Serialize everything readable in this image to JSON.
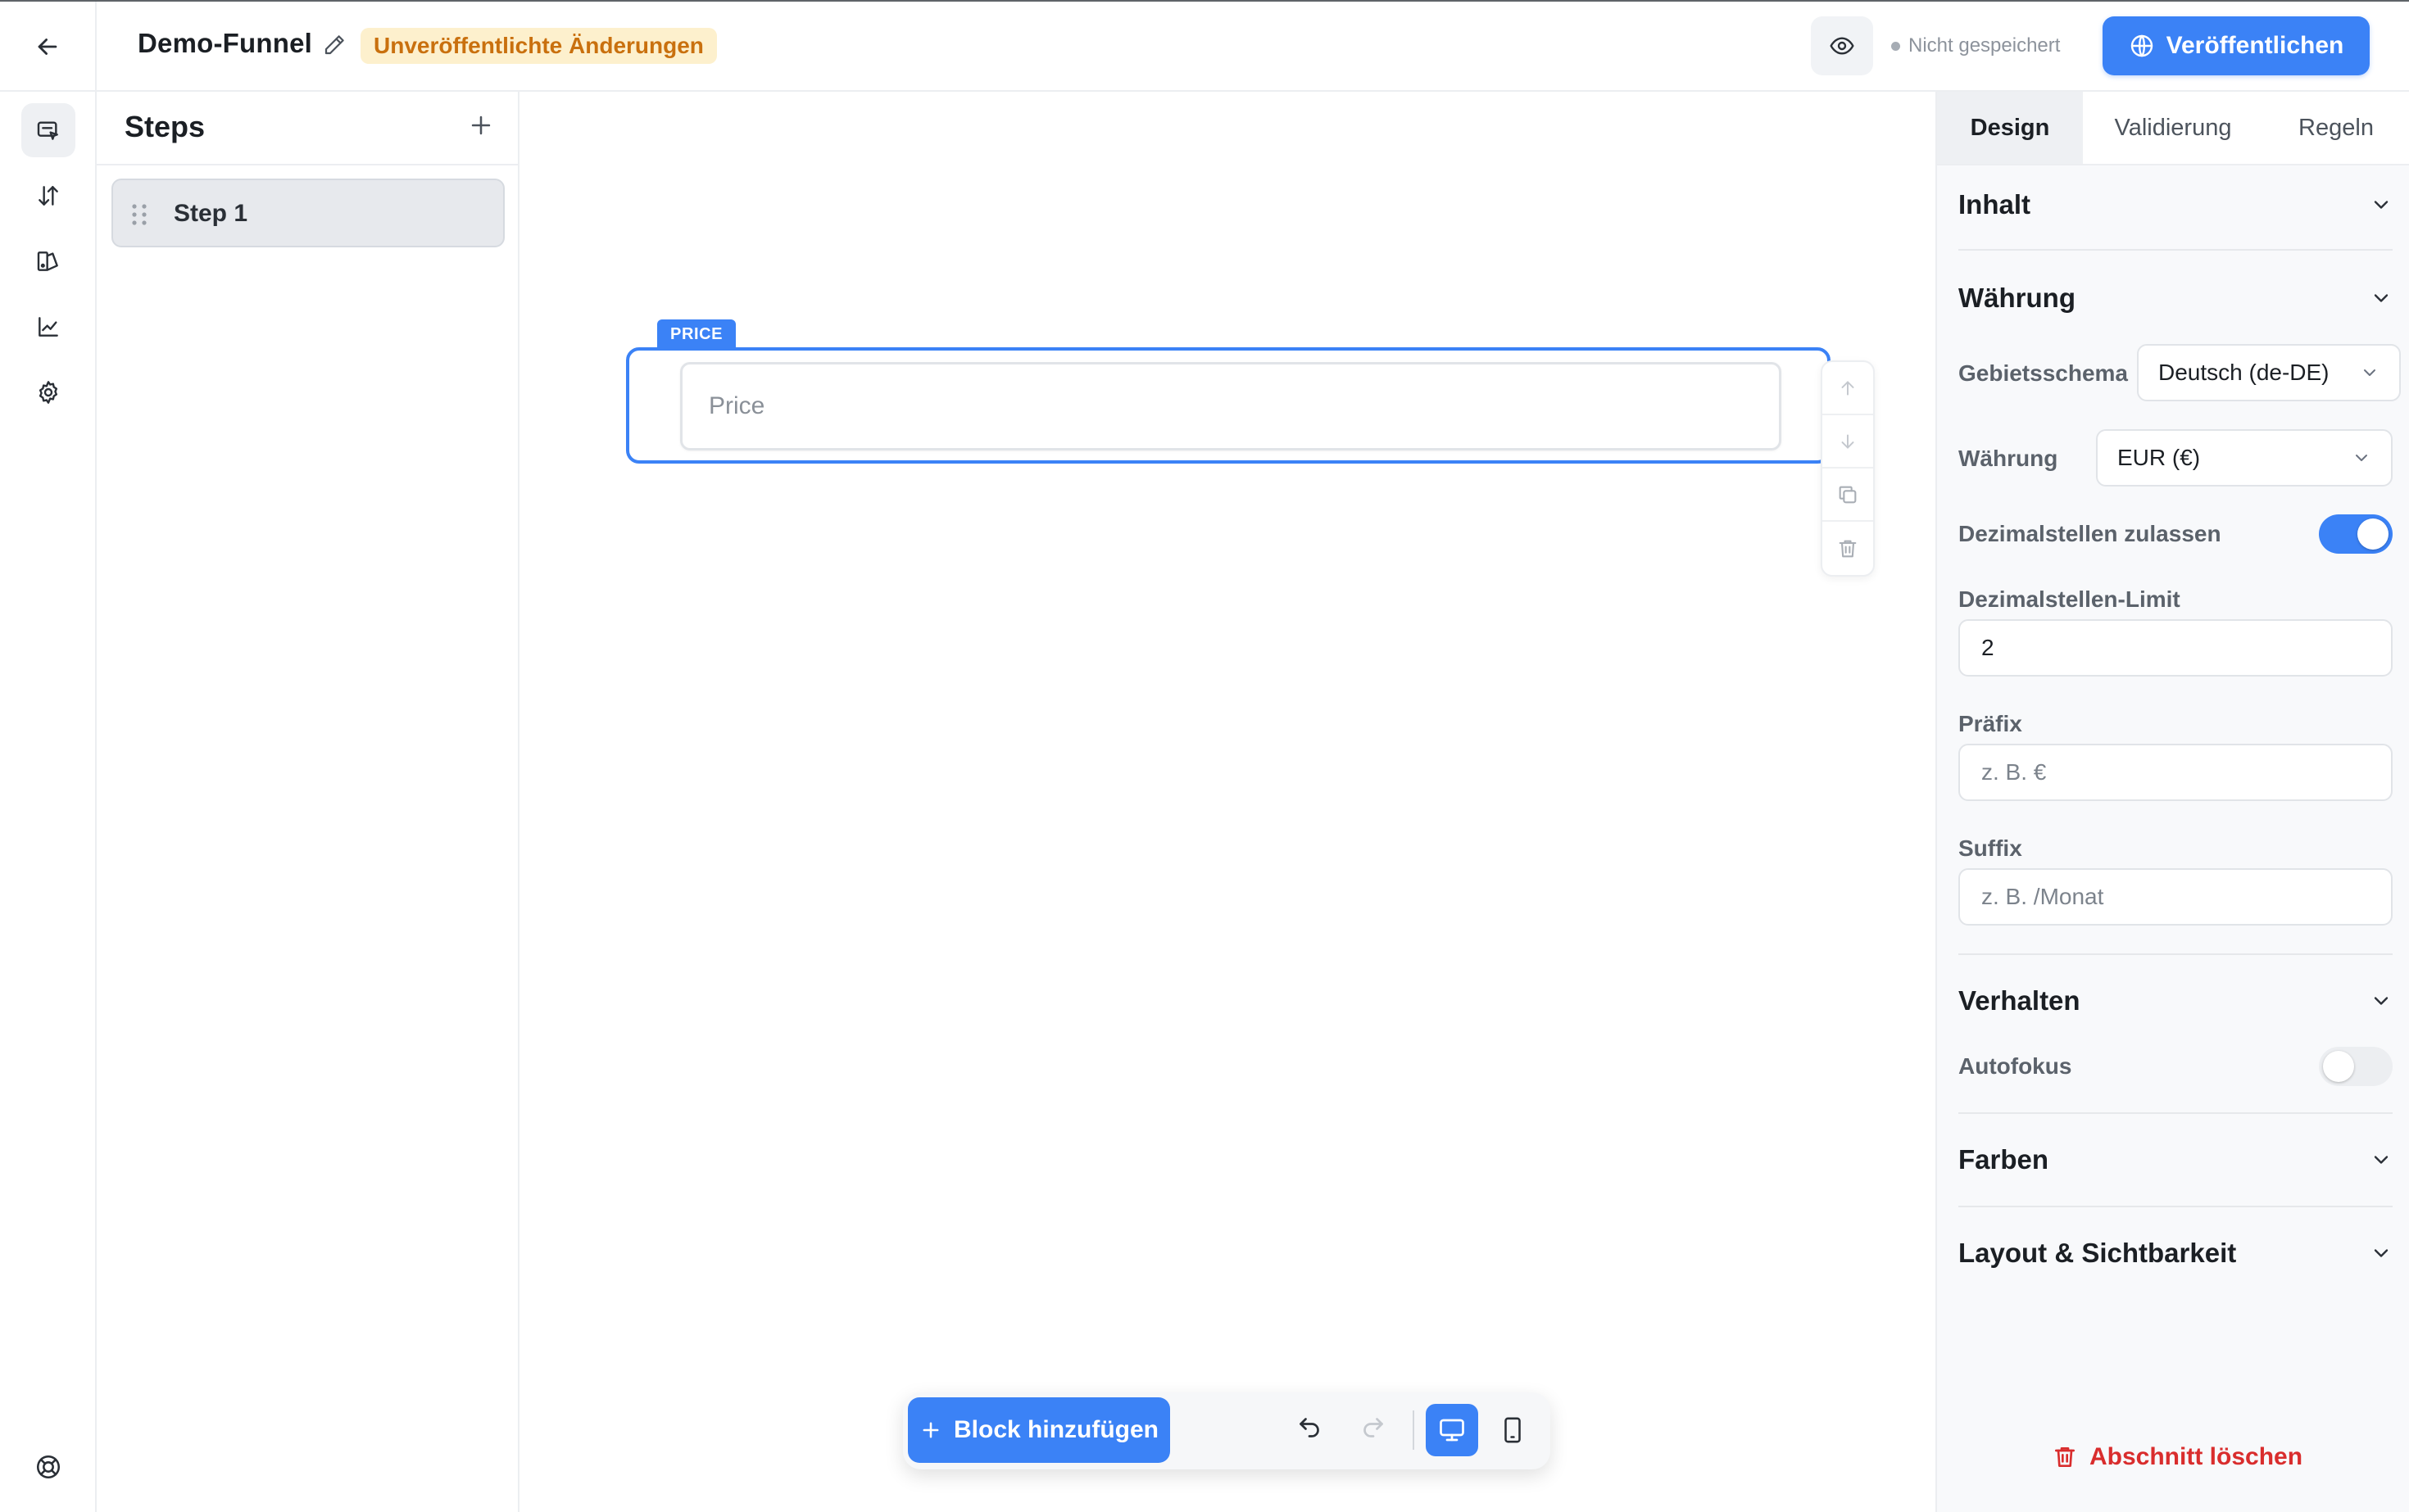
{
  "header": {
    "funnel_title": "Demo-Funnel",
    "unpublished_badge": "Unveröffentlichte Änderungen",
    "save_status": "Nicht gespeichert",
    "publish_label": "Veröffentlichen"
  },
  "rail": {
    "items": [
      "editor-icon",
      "sort-icon",
      "theme-icon",
      "analytics-icon",
      "settings-icon"
    ],
    "bottom": "help-icon"
  },
  "steps": {
    "title": "Steps",
    "items": [
      {
        "label": "Step 1"
      }
    ]
  },
  "canvas": {
    "block_tag": "PRICE",
    "price_placeholder": "Price",
    "add_block_label": "Block hinzufügen"
  },
  "settings": {
    "tabs": [
      {
        "label": "Design",
        "active": true
      },
      {
        "label": "Validierung",
        "active": false
      },
      {
        "label": "Regeln",
        "active": false
      }
    ],
    "sections": {
      "inhalt": "Inhalt",
      "waehrung": "Währung",
      "verhalten": "Verhalten",
      "farben": "Farben",
      "layout": "Layout & Sichtbarkeit"
    },
    "fields": {
      "locale_label": "Gebietsschema",
      "locale_value": "Deutsch (de-DE)",
      "currency_label": "Währung",
      "currency_value": "EUR (€)",
      "decimals_label": "Dezimalstellen zulassen",
      "decimals_enabled": true,
      "decimal_limit_label": "Dezimalstellen-Limit",
      "decimal_limit_value": "2",
      "prefix_label": "Präfix",
      "prefix_placeholder": "z. B. €",
      "suffix_label": "Suffix",
      "suffix_placeholder": "z. B. /Monat",
      "autofocus_label": "Autofokus",
      "autofocus_enabled": false
    },
    "delete_label": "Abschnitt löschen"
  },
  "colors": {
    "accent": "#3b82f6",
    "badge_bg": "#fdf0cd",
    "badge_text": "#c9700e",
    "danger": "#d92d2d"
  }
}
